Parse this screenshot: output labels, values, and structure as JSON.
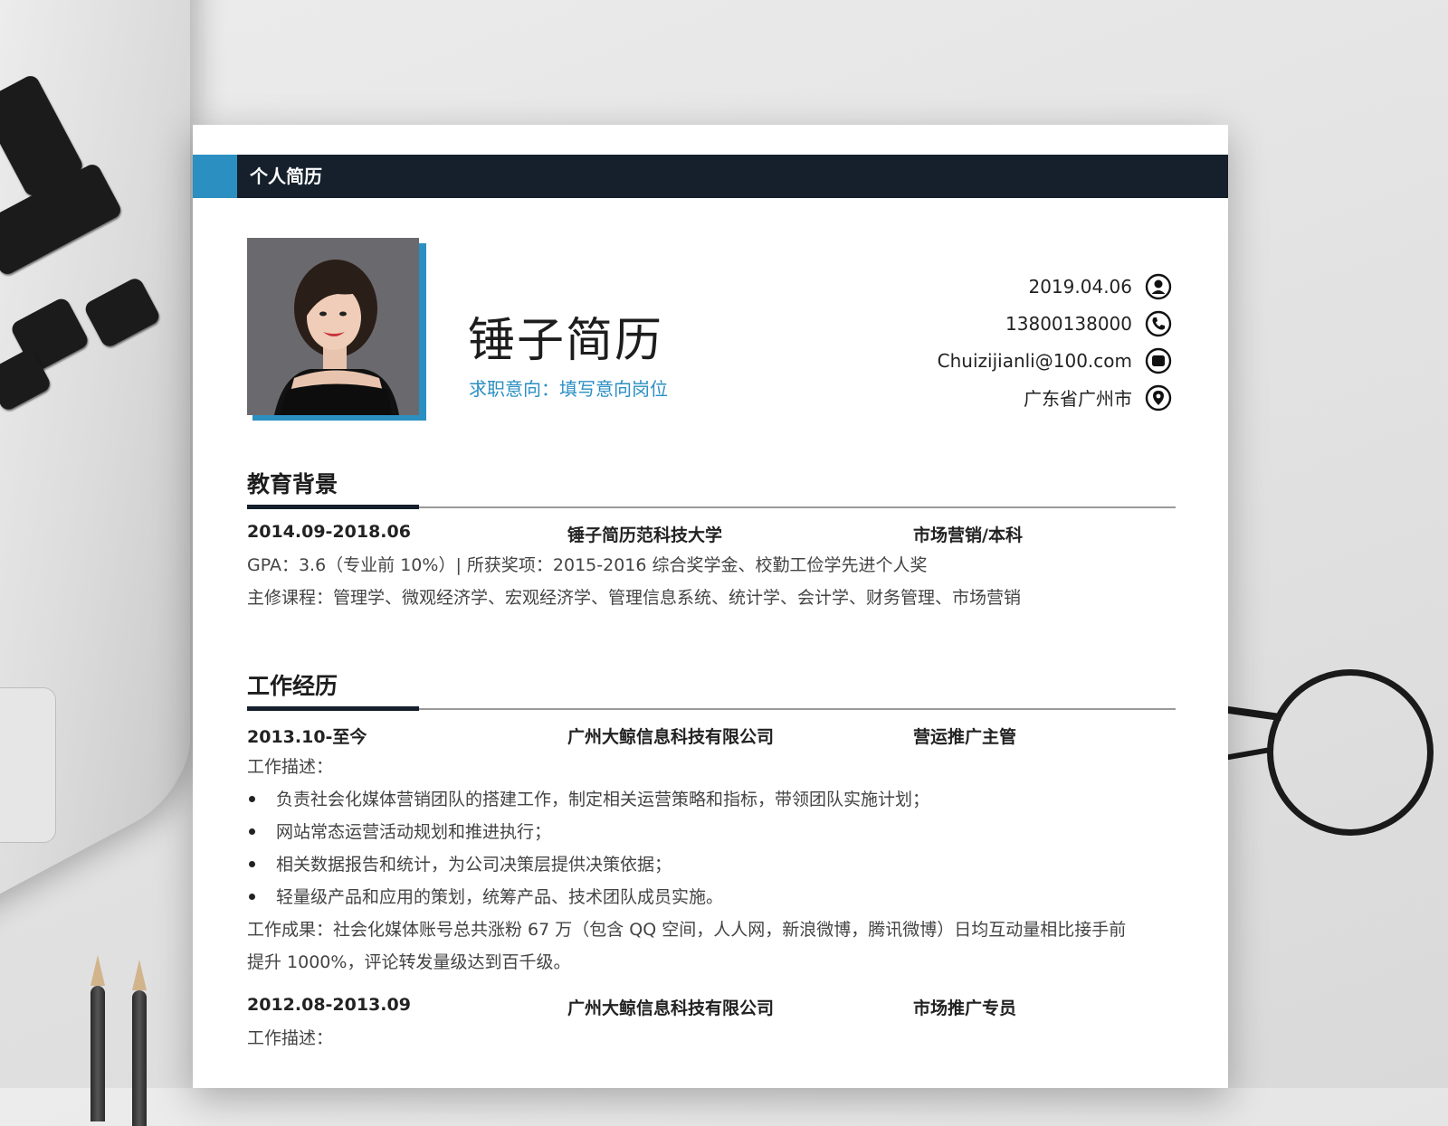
{
  "header": {
    "title": "个人简历"
  },
  "profile": {
    "name": "锤子简历",
    "intent": "求职意向：填写意向岗位"
  },
  "contact": [
    {
      "text": "2019.04.06",
      "icon": "person-icon"
    },
    {
      "text": "13800138000",
      "icon": "phone-icon"
    },
    {
      "text": "Chuizijianli@100.com",
      "icon": "email-icon"
    },
    {
      "text": "广东省广州市",
      "icon": "location-pin-icon"
    }
  ],
  "education": {
    "title": "教育背景",
    "period": "2014.09-2018.06",
    "school": "锤子简历范科技大学",
    "major": "市场营销/本科",
    "gpa": "GPA：3.6（专业前 10%）| 所获奖项：2015-2016 综合奖学金、校勤工俭学先进个人奖",
    "courses": "主修课程：管理学、微观经济学、宏观经济学、管理信息系统、统计学、会计学、财务管理、市场营销"
  },
  "work": {
    "title": "工作经历",
    "jobs": [
      {
        "period": "2013.10-至今",
        "company": "广州大鲸信息科技有限公司",
        "position": "营运推广主管",
        "desc_label": "工作描述：",
        "bullets": [
          "负责社会化媒体营销团队的搭建工作，制定相关运营策略和指标，带领团队实施计划；",
          "网站常态运营活动规划和推进执行；",
          "相关数据报告和统计，为公司决策层提供决策依据；",
          "轻量级产品和应用的策划，统筹产品、技术团队成员实施。"
        ],
        "result_1": "工作成果：社会化媒体账号总共涨粉 67 万（包含 QQ 空间，人人网，新浪微博，腾讯微博）日均互动量相比接手前",
        "result_2": "提升 1000%，评论转发量级达到百千级。"
      },
      {
        "period": "2012.08-2013.09",
        "company": "广州大鲸信息科技有限公司",
        "position": "市场推广专员",
        "desc_label": "工作描述："
      }
    ]
  },
  "colors": {
    "accent": "#2b8fc2",
    "dark": "#15202c"
  }
}
